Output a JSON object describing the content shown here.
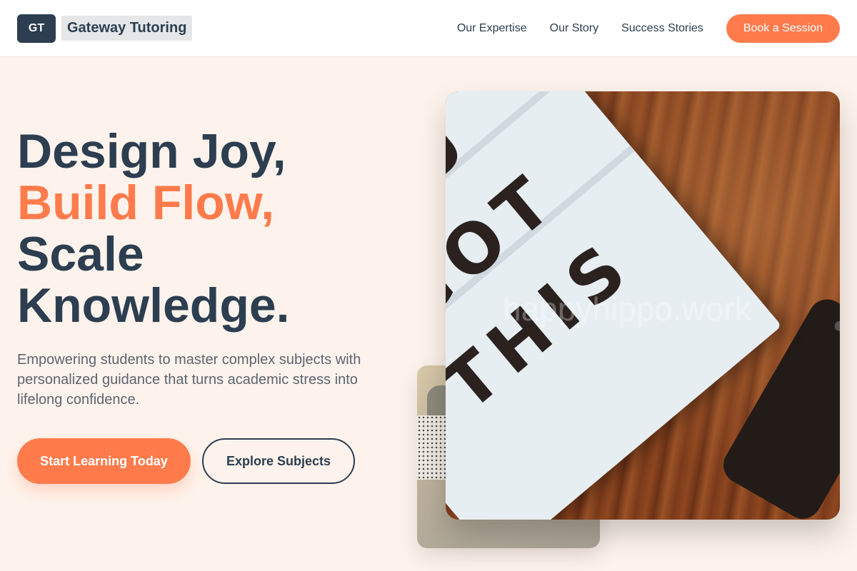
{
  "header": {
    "logo_initials": "GT",
    "brand": "Gateway Tutoring",
    "nav": [
      "Our Expertise",
      "Our Story",
      "Success Stories"
    ],
    "cta": "Book a Session"
  },
  "hero": {
    "title_line1": "Design Joy,",
    "title_line2": "Build Flow,",
    "title_line3": "Scale",
    "title_line4": "Knowledge.",
    "subtitle": "Empowering students to master complex subjects with personalized guidance that turns academic stress into lifelong confidence.",
    "primary_button": "Start Learning Today",
    "secondary_button": "Explore Subjects"
  },
  "image": {
    "lightbox_lines": [
      "OU",
      "GOT",
      "THIS"
    ],
    "watermark": "happyhippo.work"
  },
  "colors": {
    "accent": "#ff7b4c",
    "dark": "#2c3e50",
    "background": "#fef3ec"
  }
}
